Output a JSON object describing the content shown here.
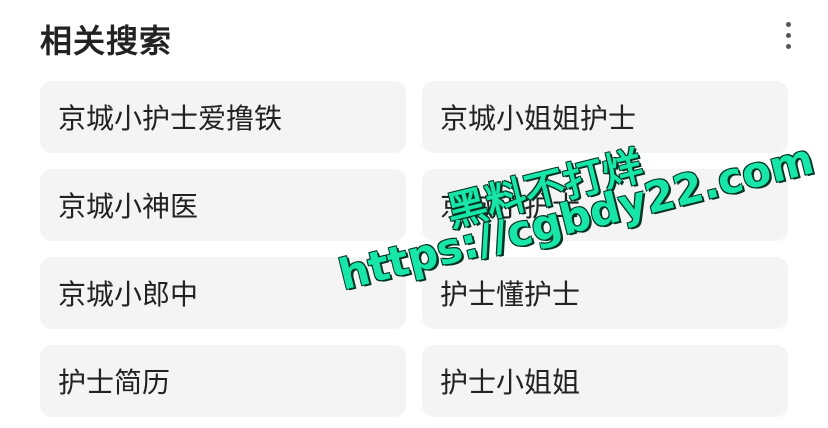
{
  "header": {
    "title": "相关搜索",
    "more_icon": "more-vertical-icon"
  },
  "chips": [
    {
      "label": "京城小护士爱撸铁"
    },
    {
      "label": "京城小姐姐护士"
    },
    {
      "label": "京城小神医"
    },
    {
      "label": "京城小护士"
    },
    {
      "label": "京城小郎中"
    },
    {
      "label": "护士懂护士"
    },
    {
      "label": "护士简历"
    },
    {
      "label": "护士小姐姐"
    }
  ],
  "watermark": {
    "line1": "黑料不打烊",
    "line2": "https://cgbdy22.com",
    "color": "#18e6a8"
  },
  "colors": {
    "chip_background": "#f4f4f4",
    "text": "#222222"
  }
}
